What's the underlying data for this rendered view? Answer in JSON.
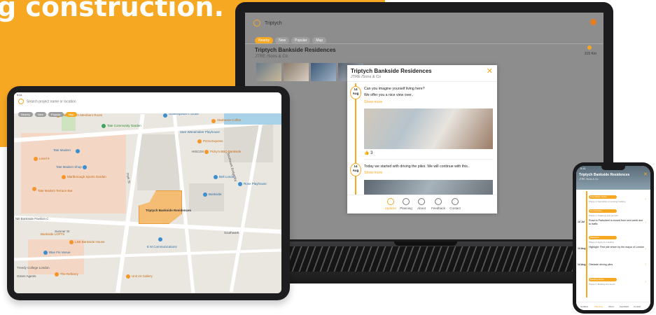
{
  "hero": {
    "text": "g construction."
  },
  "laptop": {
    "search_value": "Triptych",
    "chips": [
      "Nearby",
      "New",
      "Popular",
      "Map"
    ],
    "project_title": "Triptych Bankside Residences",
    "project_subtitle": "JTRE /Sons & Co",
    "distance": "315 Km",
    "popup": {
      "title": "Triptych Bankside Residences",
      "subtitle": "JTRE /Sons & Co",
      "close_glyph": "✕",
      "post1": {
        "day": "14",
        "month": "Aug",
        "line1": "Can you imagine yourself living here?",
        "line2": "We offer you a nice view over..",
        "more": "Show more",
        "likes": "3"
      },
      "post2": {
        "day": "14",
        "month": "Aug",
        "line1": "Today we started with driving the piles. We will continue with this..",
        "more": "Show more"
      },
      "nav": [
        "Updates",
        "Planning",
        "About",
        "Feedback",
        "Contact"
      ]
    }
  },
  "tablet": {
    "time": "9:41",
    "search_placeholder": "Search project name or location",
    "chips": [
      "Nearby",
      "New",
      "Popular",
      "Map"
    ],
    "map_labels": {
      "tate_modern": "Tate Modern",
      "tate_modern_shop": "Tate Modern Shop",
      "level9": "Level 9",
      "tate_bar": "Tate Modern Terrace Bar",
      "members_room": "Tate Modern Members Room",
      "tate_community": "Tate Community Garden",
      "shakespeare": "Shakespeare's Globe",
      "starbucks": "Starbucks Coffee",
      "sam_wanamaker": "Sam Wanamaker Playhouse",
      "pizza_express": "Pizza Express",
      "hiscox": "HISCOX",
      "picky": "Picky's BBQ Bankside",
      "bell_london": "Bell London",
      "rose_playhouse": "Rose Playhouse",
      "project_label": "Triptych Bankside Residences",
      "bankside": "Bankside",
      "southwark": "Southwark",
      "em_comms": "E M Communications",
      "lse_bankside": "LSE Bankside House",
      "blue_fin": "Blue Fin Venue",
      "trinity": "Treedy College London",
      "green_agents": "Green Agents",
      "refinery": "The Refinery",
      "unit24": "Unit 24 Gallery",
      "sumner": "Sumner St",
      "park_st": "Park St",
      "marlborough": "Marlborough Sports Garden",
      "bankside_lofts": "Bankside LOFTS",
      "nb_bankside": "NB Bankside Pavilion C",
      "southwark_bridge": "Southwark Bridge Rd"
    }
  },
  "phone": {
    "time": "9:41",
    "title": "Triptych Bankside Residences",
    "subtitle": "JTRE /Sons & Co",
    "close_glyph": "✕",
    "items": [
      {
        "tag": "Foundation works",
        "sm": "Phase 1: Demolition of existing building"
      },
      {
        "tag": "Construction",
        "sm": "Phase 1: Drawings and permits",
        "date": "14 Jul",
        "text": "Road to Parkstreet is closed from next week due to traffic"
      },
      {
        "tag": "Milestone",
        "sm": "Phase 2: Apply for building",
        "date": "14 Aug",
        "text": "Highlight: First pile driven by the mayor of London"
      },
      {
        "tag": "",
        "sm": "",
        "date": "14 Aug",
        "text": "Obstacle driving piles"
      },
      {
        "tag": "Building works",
        "sm": "Phase 3: Building first levels"
      }
    ],
    "nav": [
      "Updates",
      "Planning",
      "About",
      "Feedback",
      "Contact"
    ]
  }
}
